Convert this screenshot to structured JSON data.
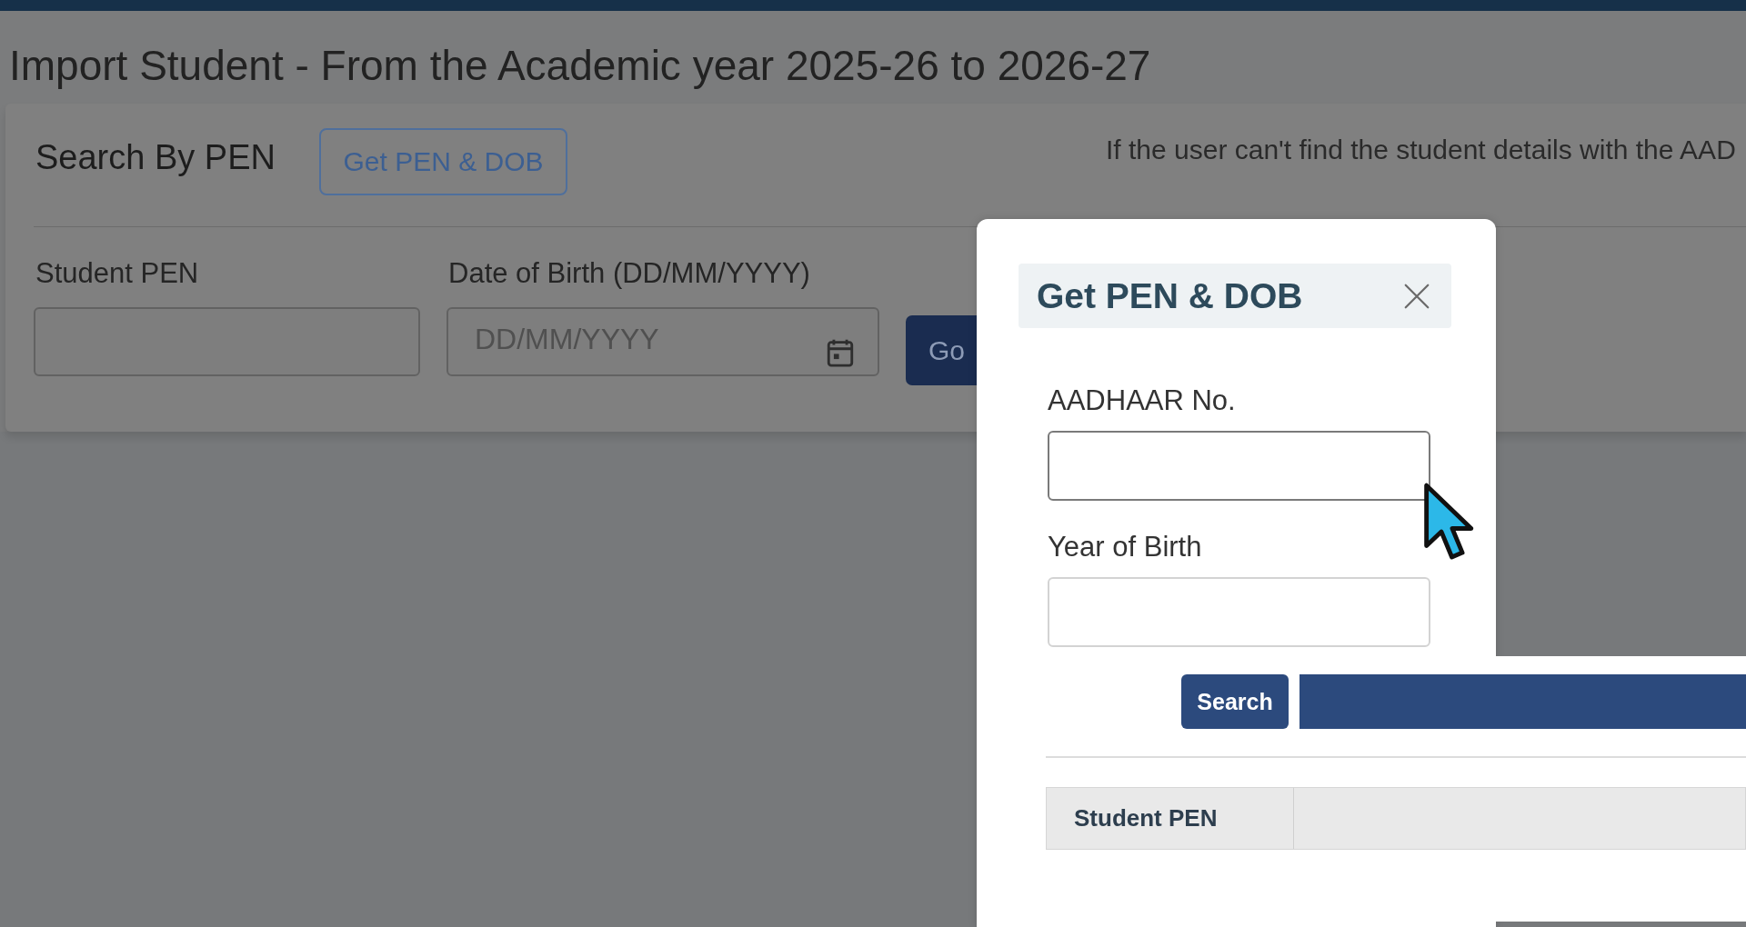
{
  "page": {
    "title": "Import Student - From the Academic year 2025-26 to 2026-27"
  },
  "search_card": {
    "title": "Search By PEN",
    "lookup_button": "Get PEN & DOB",
    "note": "If the user can't find the student details with the AAD",
    "fields": [
      {
        "kind": "text",
        "label": "Student PEN"
      },
      {
        "kind": "date",
        "label": "Date of Birth (DD/MM/YYYY)",
        "placeholder": "DD/MM/YYYY"
      }
    ],
    "go_button": "Go"
  },
  "modal": {
    "title": "Get PEN & DOB",
    "fields": [
      {
        "label": "AADHAAR No.",
        "focused": true
      },
      {
        "label": "Year of Birth",
        "focused": false
      }
    ],
    "search_button": "Search",
    "table": {
      "columns": [
        "Student PEN"
      ]
    }
  }
}
